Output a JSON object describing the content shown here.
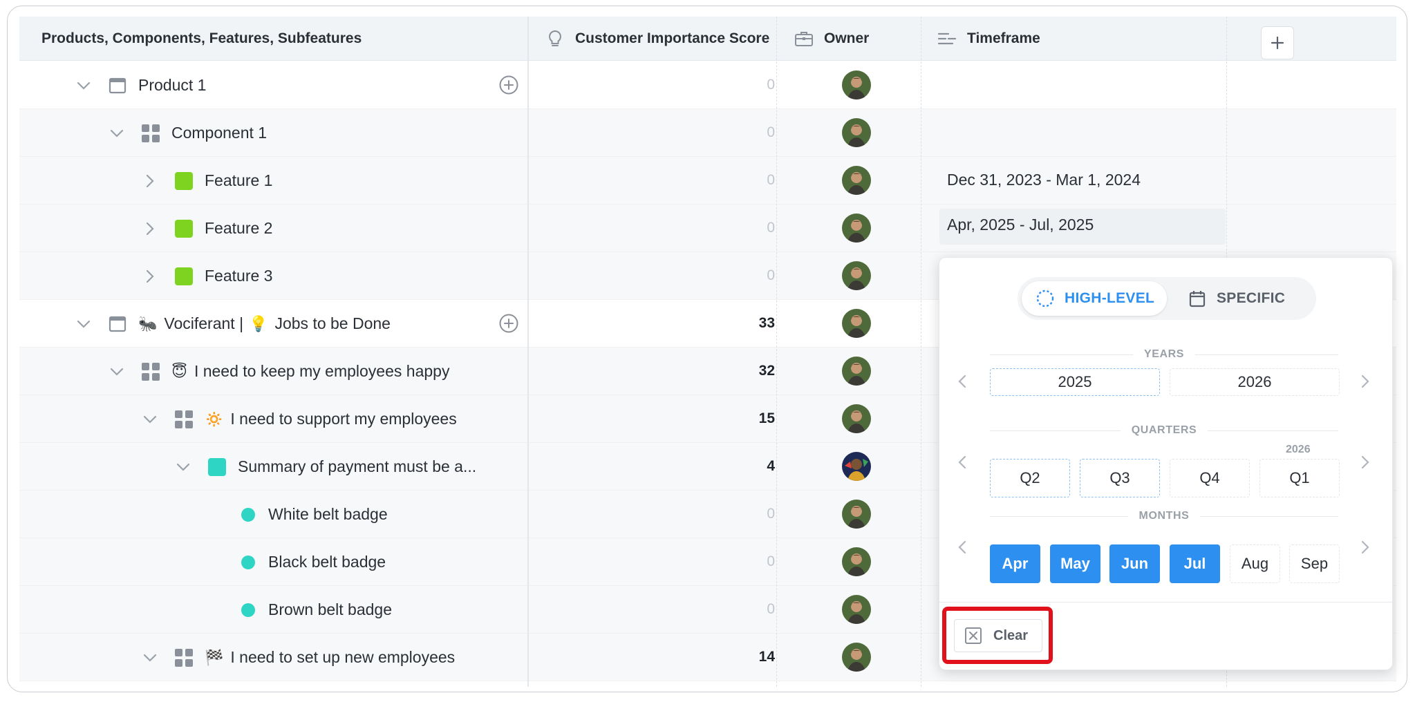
{
  "header": {
    "col_name": "Products, Components, Features, Subfeatures",
    "col_score": "Customer Importance Score",
    "col_owner": "Owner",
    "col_timeframe": "Timeframe",
    "add_column_label": "+"
  },
  "rows": [
    {
      "name": "Product 1",
      "emoji": "",
      "score": "0",
      "timeframe": ""
    },
    {
      "name": "Component 1",
      "emoji": "",
      "score": "0",
      "timeframe": ""
    },
    {
      "name": "Feature 1",
      "emoji": "",
      "score": "0",
      "timeframe": "Dec 31, 2023 - Mar 1, 2024"
    },
    {
      "name": "Feature 2",
      "emoji": "",
      "score": "0",
      "timeframe": "Apr, 2025 - Jul, 2025"
    },
    {
      "name": "Feature 3",
      "emoji": "",
      "score": "0",
      "timeframe": ""
    },
    {
      "name": "Vociferant | ",
      "name2": "Jobs to be Done",
      "emoji": "🐜",
      "emoji2": "💡",
      "score": "33",
      "timeframe": ""
    },
    {
      "name": "I need to keep my employees happy",
      "emoji": "😇",
      "score": "32",
      "timeframe": ""
    },
    {
      "name": "I need to support my employees",
      "emoji": "🔅",
      "score": "15",
      "timeframe": ""
    },
    {
      "name": "Summary of payment must be a...",
      "emoji": "",
      "score": "4",
      "timeframe": ""
    },
    {
      "name": "White belt badge",
      "emoji": "",
      "score": "0",
      "timeframe": ""
    },
    {
      "name": "Black belt badge",
      "emoji": "",
      "score": "0",
      "timeframe": ""
    },
    {
      "name": "Brown belt badge",
      "emoji": "",
      "score": "0",
      "timeframe": ""
    },
    {
      "name": "I need to set up new employees",
      "emoji": "🏁",
      "score": "14",
      "timeframe": ""
    }
  ],
  "popup": {
    "tab_high_level": "HIGH-LEVEL",
    "tab_specific": "SPECIFIC",
    "years_label": "YEARS",
    "years": [
      "2025",
      "2026"
    ],
    "quarters_label": "QUARTERS",
    "quarters": [
      "Q2",
      "Q3",
      "Q4",
      "Q1"
    ],
    "quarter_year_tag": "2026",
    "months_label": "MONTHS",
    "months": [
      "Apr",
      "May",
      "Jun",
      "Jul",
      "Aug",
      "Sep"
    ],
    "selected_months": [
      "Apr",
      "May",
      "Jun",
      "Jul"
    ],
    "clear_label": "Clear"
  },
  "colors": {
    "accent": "#2d8ff0",
    "feature_green": "#7ed321",
    "teal": "#2ed5c4",
    "highlight_red": "#e0111b",
    "zero_score": "#c2c6cc"
  }
}
